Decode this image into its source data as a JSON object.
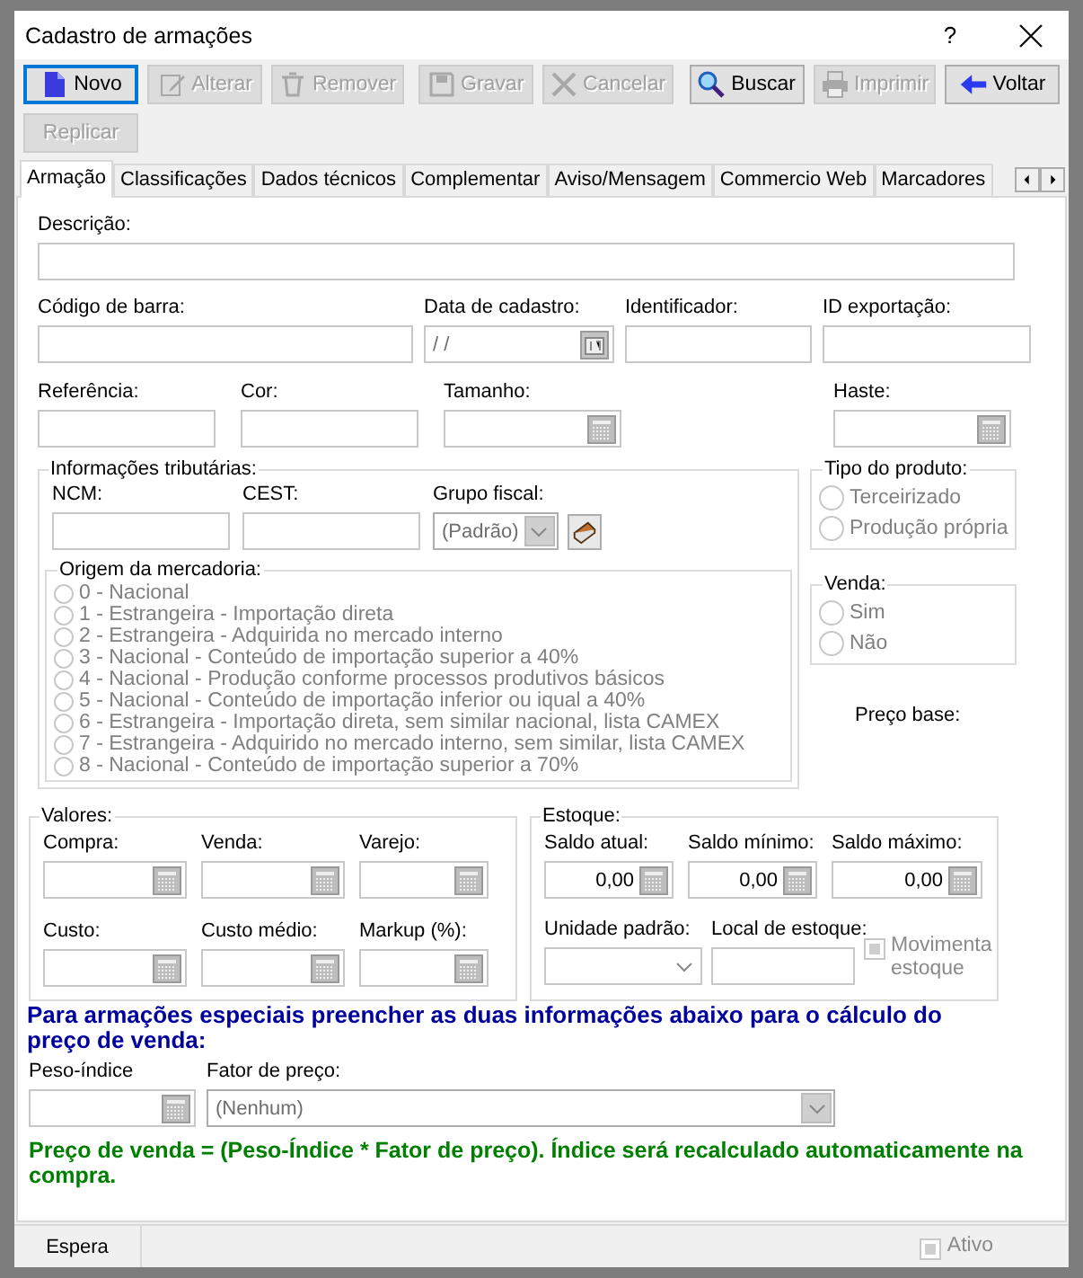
{
  "window": {
    "title": "Cadastro de armações",
    "help": "?"
  },
  "toolbar": [
    {
      "label": "Novo",
      "kind": "new",
      "disabled": false,
      "focused": true
    },
    {
      "label": "Alterar",
      "kind": "edit",
      "disabled": true,
      "focused": false
    },
    {
      "label": "Remover",
      "kind": "remove",
      "disabled": true,
      "focused": false
    },
    {
      "label": "Gravar",
      "kind": "save",
      "disabled": true,
      "focused": false
    },
    {
      "label": "Cancelar",
      "kind": "cancel",
      "disabled": true,
      "focused": false
    },
    {
      "label": "Buscar",
      "kind": "search",
      "disabled": false,
      "focused": false
    },
    {
      "label": "Imprimir",
      "kind": "print",
      "disabled": true,
      "focused": false
    },
    {
      "label": "Voltar",
      "kind": "back",
      "disabled": false,
      "focused": false
    }
  ],
  "toolbar2": [
    {
      "label": "Replicar",
      "disabled": true,
      "focused": false
    }
  ],
  "tabs": [
    {
      "label": "Armação",
      "selected": true
    },
    {
      "label": "Classificações",
      "selected": false
    },
    {
      "label": "Dados técnicos",
      "selected": false
    },
    {
      "label": "Complementar",
      "selected": false
    },
    {
      "label": "Aviso/Mensagem",
      "selected": false
    },
    {
      "label": "Commercio Web",
      "selected": false
    },
    {
      "label": "Marcadores",
      "selected": false
    }
  ],
  "form": {
    "row1": [
      {
        "label": "Descrição:",
        "kind": "text"
      }
    ],
    "row2": [
      {
        "label": "Código de barra:",
        "kind": "text"
      },
      {
        "label": "Data de cadastro:",
        "kind": "date",
        "value": "/ /"
      },
      {
        "label": "Identificador:",
        "kind": "text"
      },
      {
        "label": "ID exportação:",
        "kind": "text"
      }
    ],
    "row3": [
      {
        "label": "Referência:",
        "kind": "text"
      },
      {
        "label": "Cor:",
        "kind": "text"
      },
      {
        "label": "Tamanho:",
        "kind": "number"
      },
      {
        "label": "Haste:",
        "kind": "number"
      }
    ],
    "tax_info": {
      "title": "Informações tributárias:",
      "fields": [
        {
          "label": "NCM:",
          "kind": "text"
        },
        {
          "label": "CEST:",
          "kind": "text"
        },
        {
          "label": "Grupo fiscal:",
          "kind": "combo",
          "value": "(Padrão)",
          "disabled": true
        }
      ],
      "origin": {
        "title": "Origem da mercadoria:",
        "disabled": true,
        "options": [
          {
            "label": "0 - Nacional",
            "selected": false
          },
          {
            "label": "1 - Estrangeira - Importação direta",
            "selected": false
          },
          {
            "label": "2 - Estrangeira - Adquirida no mercado interno",
            "selected": false
          },
          {
            "label": "3 - Nacional - Conteúdo de importação superior a 40%",
            "selected": false
          },
          {
            "label": "4 - Nacional - Produção conforme processos produtivos básicos",
            "selected": false
          },
          {
            "label": "5 - Nacional - Conteúdo de importação inferior ou iqual a 40%",
            "selected": false
          },
          {
            "label": "6 - Estrangeira - Importação direta, sem similar nacional, lista CAMEX",
            "selected": false
          },
          {
            "label": "7 - Estrangeira - Adquirido no mercado interno, sem similar, lista CAMEX",
            "selected": false
          },
          {
            "label": "8 - Nacional - Conteúdo de importação superior a 70%",
            "selected": false
          }
        ]
      }
    },
    "product_type": {
      "title": "Tipo do produto:",
      "disabled": true,
      "options": [
        {
          "label": "Terceirizado",
          "selected": false
        },
        {
          "label": "Produção própria",
          "selected": false
        }
      ]
    },
    "sale": {
      "title": "Venda:",
      "disabled": true,
      "options": [
        {
          "label": "Sim",
          "selected": false
        },
        {
          "label": "Não",
          "selected": false
        }
      ]
    },
    "base_price_label": "Preço base:",
    "values": {
      "title": "Valores:",
      "fields": [
        {
          "label": "Compra:",
          "kind": "number"
        },
        {
          "label": "Venda:",
          "kind": "number"
        },
        {
          "label": "Varejo:",
          "kind": "number"
        },
        {
          "label": "Custo:",
          "kind": "number"
        },
        {
          "label": "Custo médio:",
          "kind": "number"
        },
        {
          "label": "Markup (%):",
          "kind": "number"
        }
      ]
    },
    "stock": {
      "title": "Estoque:",
      "fields": [
        {
          "label": "Saldo atual:",
          "kind": "number",
          "value": "0,00"
        },
        {
          "label": "Saldo mínimo:",
          "kind": "number",
          "value": "0,00"
        },
        {
          "label": "Saldo máximo:",
          "kind": "number",
          "value": "0,00"
        }
      ],
      "unit": {
        "label": "Unidade padrão:",
        "kind": "combo",
        "disabled": false
      },
      "location": {
        "label": "Local de estoque:",
        "kind": "text"
      },
      "moves_stock": {
        "label": "Movimenta estoque",
        "indeterminate": true,
        "disabled": true
      }
    },
    "notice": "Para armações especiais preencher as duas informações abaixo para o cálculo do preço de venda:",
    "weight_row": [
      {
        "label": "Peso-índice",
        "kind": "number"
      },
      {
        "label": "Fator de preço:",
        "kind": "combo",
        "value": "(Nenhum)",
        "disabled": true
      }
    ],
    "formula": "Preço de venda = (Peso-Índice * Fator de preço). Índice será recalculado automaticamente na compra."
  },
  "status_bar": {
    "state": "Espera",
    "active": {
      "label": "Ativo",
      "indeterminate": true,
      "disabled": true
    }
  }
}
